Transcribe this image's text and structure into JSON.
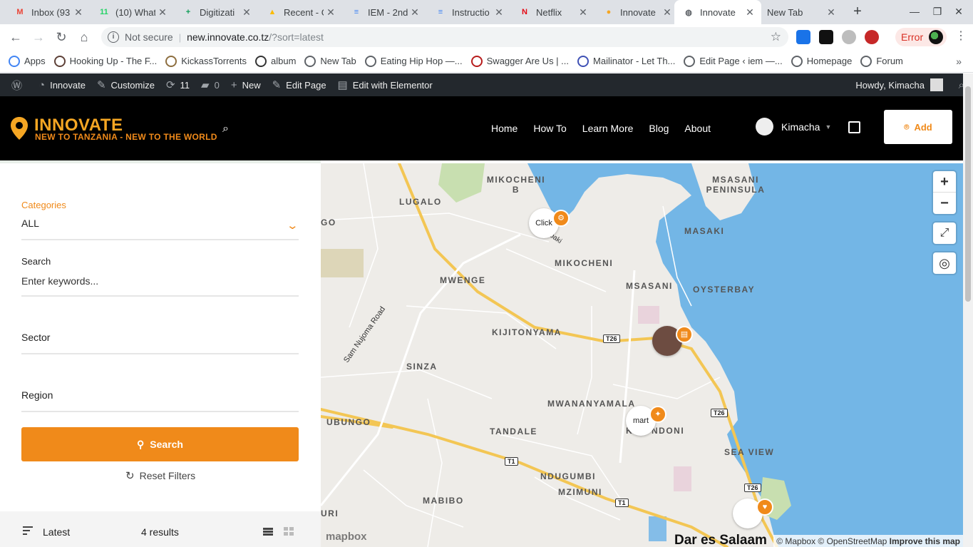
{
  "browser": {
    "tabs": [
      {
        "title": "Inbox (93",
        "favicon": "gmail-icon",
        "color": "#ea4335",
        "glyph": "M"
      },
      {
        "title": "(10) What",
        "favicon": "whatsapp-icon",
        "color": "#25d366",
        "glyph": "11"
      },
      {
        "title": "Digitizati",
        "favicon": "sheets-icon",
        "color": "#0f9d58",
        "glyph": "+"
      },
      {
        "title": "Recent - G",
        "favicon": "drive-icon",
        "color": "#fbbc04",
        "glyph": "▲"
      },
      {
        "title": "IEM - 2nd",
        "favicon": "docs-icon",
        "color": "#4285f4",
        "glyph": "≡"
      },
      {
        "title": "Instructio",
        "favicon": "docs-icon",
        "color": "#4285f4",
        "glyph": "≡"
      },
      {
        "title": "Netflix",
        "favicon": "netflix-icon",
        "color": "#e50914",
        "glyph": "N"
      },
      {
        "title": "Innovate",
        "favicon": "innovate-pin-icon",
        "color": "#f5a623",
        "glyph": "●"
      },
      {
        "title": "Innovate",
        "favicon": "globe-icon",
        "color": "#5f6368",
        "glyph": "◍"
      },
      {
        "title": "New Tab",
        "favicon": "",
        "color": "",
        "glyph": ""
      }
    ],
    "active_tab_index": 8,
    "secure_label": "Not secure",
    "url_host": "new.innovate.co.tz",
    "url_path": "/?sort=latest",
    "error_label": "Error",
    "bookmarks": [
      {
        "label": "Apps",
        "icon": "apps-grid-icon",
        "color": "#4285f4"
      },
      {
        "label": "Hooking Up - The F...",
        "icon": "book-icon",
        "color": "#5d4037"
      },
      {
        "label": "KickassTorrents",
        "icon": "shield-icon",
        "color": "#8d6e3f"
      },
      {
        "label": "album",
        "icon": "headphones-icon",
        "color": "#333"
      },
      {
        "label": "New Tab",
        "icon": "globe-icon",
        "color": "#5f6368"
      },
      {
        "label": "Eating Hip Hop —...",
        "icon": "globe-icon",
        "color": "#5f6368"
      },
      {
        "label": "Swagger Are Us | ...",
        "icon": "emblem-icon",
        "color": "#b71c1c"
      },
      {
        "label": "Mailinator - Let Th...",
        "icon": "mail-icon",
        "color": "#3f51b5"
      },
      {
        "label": "Edit Page ‹ iem —...",
        "icon": "globe-icon",
        "color": "#5f6368"
      },
      {
        "label": "Homepage",
        "icon": "globe-icon",
        "color": "#5f6368"
      },
      {
        "label": "Forum",
        "icon": "globe-icon",
        "color": "#5f6368"
      }
    ]
  },
  "wp_admin": {
    "site_name": "Innovate",
    "customize": "Customize",
    "updates_count": "11",
    "comments_count": "0",
    "new_label": "New",
    "edit_page": "Edit Page",
    "edit_elementor": "Edit with Elementor",
    "howdy": "Howdy, Kimacha"
  },
  "header": {
    "logo_title": "INNOVATE",
    "logo_tagline": "NEW TO TANZANIA - NEW TO THE WORLD",
    "nav": [
      "Home",
      "How To",
      "Learn More",
      "Blog",
      "About"
    ],
    "user_name": "Kimacha",
    "add_label": "Add",
    "brand_color": "#f08a1a"
  },
  "filters": {
    "categories_label": "Categories",
    "categories_value": "ALL",
    "search_label": "Search",
    "search_placeholder": "Enter keywords...",
    "sector_label": "Sector",
    "region_label": "Region",
    "search_button": "Search",
    "reset_label": "Reset Filters",
    "sort_label": "Latest",
    "results_count": "4 results"
  },
  "map": {
    "area_labels": [
      "MIKOCHENI B",
      "LUGALO",
      "MSASANI PENINSULA",
      "MASAKI",
      "MIKOCHENI",
      "MWENGE",
      "MSASANI",
      "OYSTERBAY",
      "KIJITONYAMA",
      "SINZA",
      "MWANANYAMALA",
      "TANDALE",
      "KINONDONI",
      "UBUNGO",
      "SEA VIEW",
      "NDUGUMBI",
      "MZIMUNI",
      "MABIBO",
      "GO",
      "URI"
    ],
    "road_shields": [
      "T26",
      "T26",
      "T26",
      "T1",
      "T1"
    ],
    "road_name": "Sam Nujoma Road",
    "road_name_2": "Mwaikibaki",
    "marker_labels": [
      "Click",
      "mart"
    ],
    "city_label": "Dar es Salaam",
    "mapbox_logo": "mapbox",
    "attribution": "© Mapbox © OpenStreetMap",
    "improve": "Improve this map",
    "zoom_in": "+",
    "zoom_out": "−"
  }
}
